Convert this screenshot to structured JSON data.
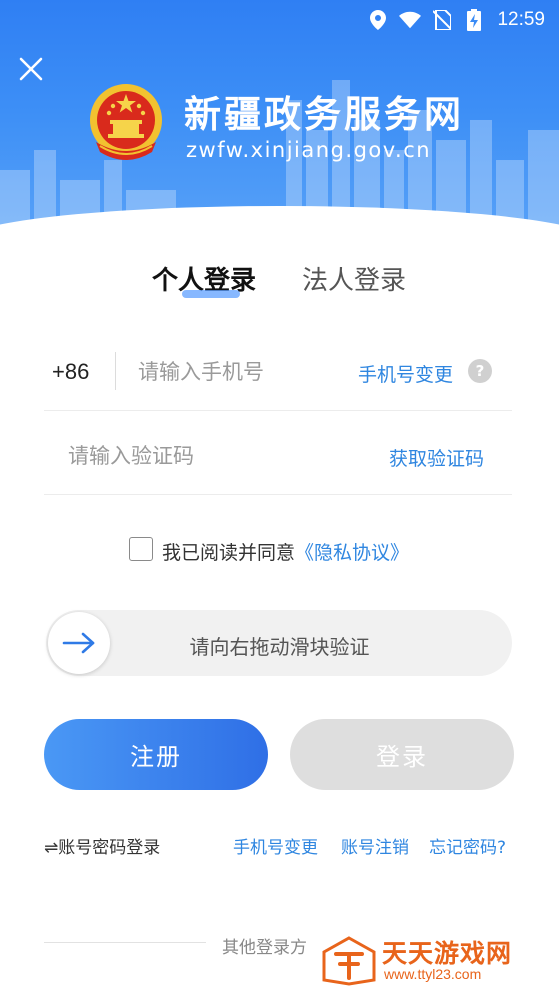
{
  "status_bar": {
    "time": "12:59",
    "icons": [
      "location-icon",
      "wifi-icon",
      "no-sim-icon",
      "battery-charging-icon"
    ]
  },
  "header": {
    "close_icon": "close-icon",
    "emblem": "national-emblem",
    "title": "新疆政务服务网",
    "url": "zwfw.xinjiang.gov.cn"
  },
  "tabs": [
    {
      "label": "个人登录",
      "active": true
    },
    {
      "label": "法人登录",
      "active": false
    }
  ],
  "form": {
    "country_code": "+86",
    "phone_placeholder": "请输入手机号",
    "phone_change_link": "手机号变更",
    "help_icon": "?",
    "code_placeholder": "请输入验证码",
    "get_code_link": "获取验证码",
    "agree_text": "我已阅读并同意",
    "agree_link": "《隐私协议》",
    "agree_checked": false
  },
  "slider": {
    "label": "请向右拖动滑块验证",
    "icon": "arrow-right-icon"
  },
  "buttons": {
    "register": "注册",
    "login": "登录"
  },
  "bottom": {
    "account_login": "⇌账号密码登录",
    "phone_change": "手机号变更",
    "account_cancel": "账号注销",
    "forgot_password": "忘记密码?"
  },
  "other_login": {
    "label": "其他登录方"
  },
  "watermark": {
    "title": "天天游戏网",
    "url": "www.ttyl23.com"
  },
  "colors": {
    "header_blue": "#2f7ff3",
    "link_blue": "#2f86e0",
    "register_gradient_start": "#4a98f5",
    "register_gradient_end": "#2f6fe6",
    "login_disabled": "#dedede",
    "watermark_orange": "#e8641b"
  }
}
